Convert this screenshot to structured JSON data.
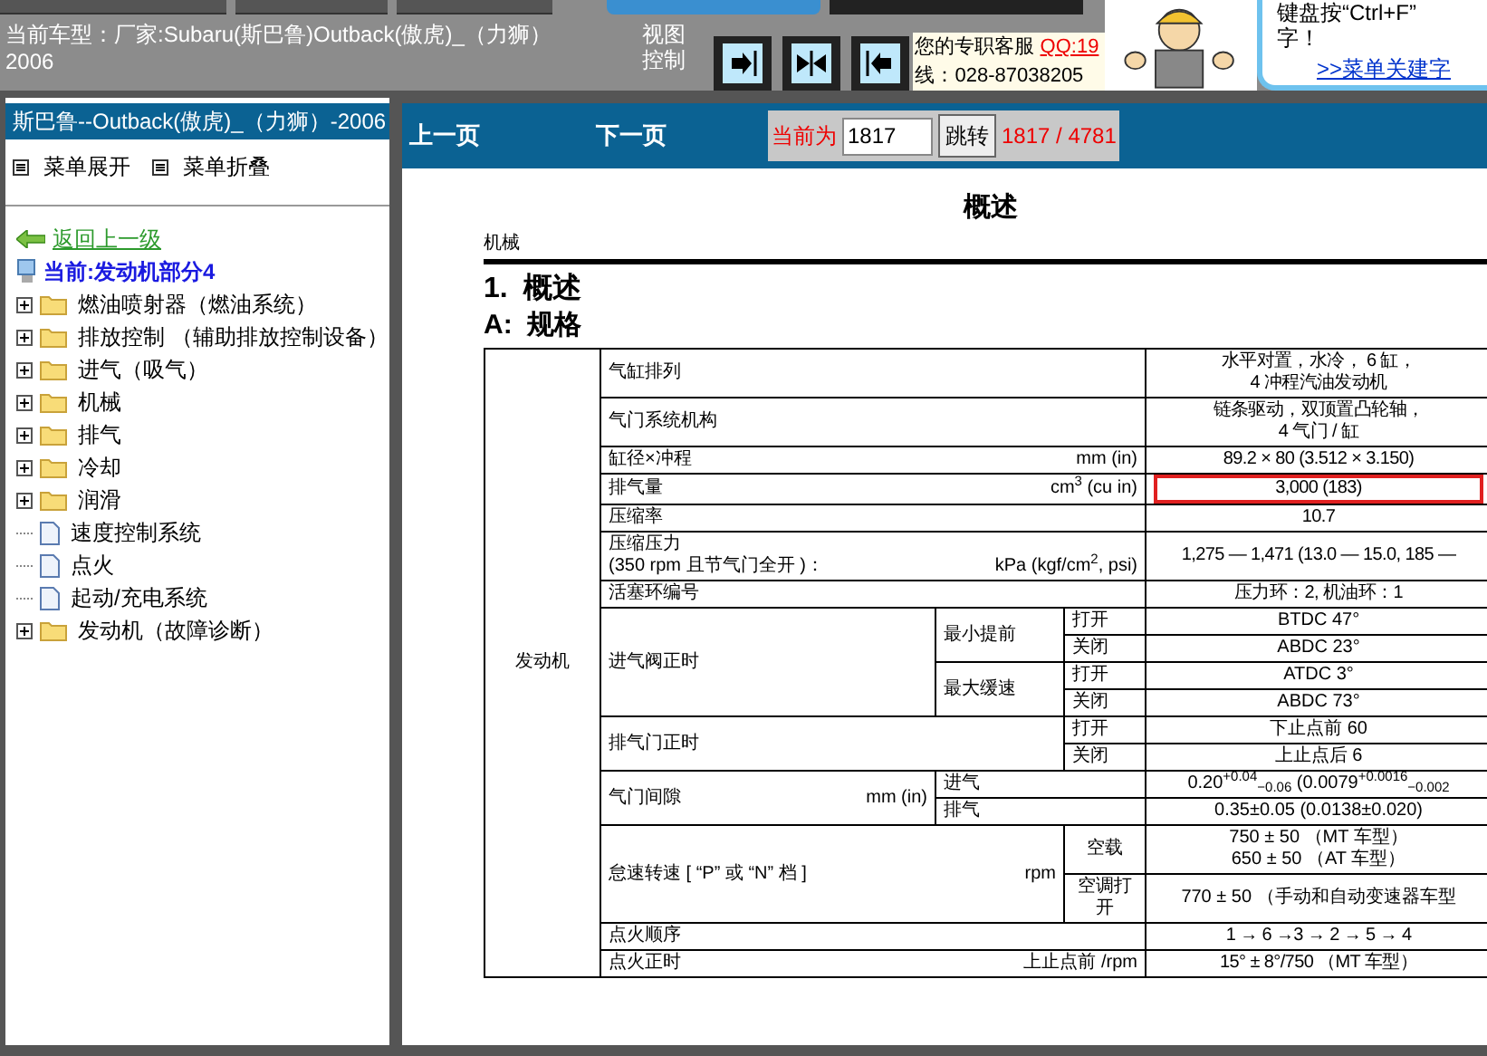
{
  "header": {
    "vehicle_lines": [
      "当前车型：厂家:Subaru(斯巴鲁)Outback(傲虎)_（力狮）",
      "2006"
    ],
    "view_label": "视图控制",
    "service_label": "您的专职客服",
    "service_qq": "QQ:19",
    "service_phone": "线：028-87038205",
    "tip_lines": [
      "键盘按“Ctrl+F”",
      "字！"
    ],
    "tip_link": ">>菜单关建字"
  },
  "sidebar": {
    "title": "斯巴鲁--Outback(傲虎)_（力狮）-2006",
    "menu_actions": [
      "菜单展开",
      "菜单折叠"
    ],
    "back_link": "返回上一级",
    "current": "当前:发动机部分4",
    "items": [
      {
        "kind": "folder",
        "label": "燃油喷射器（燃油系统）"
      },
      {
        "kind": "folder",
        "label": "排放控制 （辅助排放控制设备）"
      },
      {
        "kind": "folder",
        "label": "进气（吸气）"
      },
      {
        "kind": "folder",
        "label": "机械"
      },
      {
        "kind": "folder",
        "label": "排气"
      },
      {
        "kind": "folder",
        "label": "冷却"
      },
      {
        "kind": "folder",
        "label": "润滑"
      },
      {
        "kind": "page",
        "label": "速度控制系统"
      },
      {
        "kind": "page",
        "label": "点火"
      },
      {
        "kind": "page",
        "label": "起动/充电系统"
      },
      {
        "kind": "folder",
        "label": "发动机（故障诊断）"
      }
    ]
  },
  "pager": {
    "prev": "上一页",
    "next": "下一页",
    "current_label": "当前为",
    "page_input": "1817",
    "go_button": "跳转",
    "page_count": "1817 / 4781"
  },
  "document": {
    "page_title": "概述",
    "section": "机械",
    "heading_1": "1.  概述",
    "heading_2": "A:  规格",
    "spec_table": {
      "group": "发动机",
      "rows": [
        {
          "kind": "simple",
          "label_lines": [
            "气缸排列"
          ],
          "value_lines": [
            "水平对置，水冷， 6 缸，",
            "4 冲程汽油发动机"
          ],
          "highlighted": false
        },
        {
          "kind": "simple",
          "label_lines": [
            "气门系统机构"
          ],
          "value_lines": [
            "链条驱动，双顶置凸轮轴，",
            "4 气门 / 缸"
          ],
          "highlighted": false
        },
        {
          "kind": "simple",
          "label_lines": [
            "缸径×冲程"
          ],
          "unit": "mm (in)",
          "value_lines": [
            "89.2 × 80 (3.512 × 3.150)"
          ],
          "highlighted": false
        },
        {
          "kind": "simple",
          "label_lines": [
            "排气量"
          ],
          "unit": "cm$^{3}$ (cu in)",
          "value_lines": [
            "3,000 (183)"
          ],
          "highlighted": true
        },
        {
          "kind": "simple",
          "label_lines": [
            "压缩率"
          ],
          "value_lines": [
            "10.7"
          ],
          "highlighted": false
        },
        {
          "kind": "simple",
          "label_lines": [
            "压缩压力",
            "(350 rpm 且节气门全开 )："
          ],
          "unit": "kPa (kgf/cm$^{2}$, psi)",
          "value_lines": [
            "1,275 — 1,471 (13.0 — 15.0, 185 —"
          ],
          "highlighted": false
        },
        {
          "kind": "simple",
          "label_lines": [
            "活塞环编号"
          ],
          "value_lines": [
            "压力环：2, 机油环：1"
          ],
          "highlighted": false
        },
        {
          "kind": "timing",
          "label": "进气阀正时",
          "groups": [
            {
              "label": "最小提前",
              "entries": [
                {
                  "state": "打开",
                  "value": "BTDC 47°"
                },
                {
                  "state": "关闭",
                  "value": "ABDC 23°"
                }
              ]
            },
            {
              "label": "最大缓速",
              "entries": [
                {
                  "state": "打开",
                  "value": "ATDC 3°"
                },
                {
                  "state": "关闭",
                  "value": "ABDC 73°"
                }
              ]
            }
          ]
        },
        {
          "kind": "paired",
          "label": "排气门正时",
          "entries": [
            {
              "state": "打开",
              "value": "下止点前 60"
            },
            {
              "state": "关闭",
              "value": "上止点后 6"
            }
          ]
        },
        {
          "kind": "clearance",
          "label": "气门间隙",
          "unit": "mm (in)",
          "entries": [
            {
              "state": "进气",
              "value": "0.20$^{+0.04}$$_{−0.06}$ (0.0079$^{+0.0016}$$_{−0.002}$"
            },
            {
              "state": "排气",
              "value": "0.35±0.05 (0.0138±0.020)"
            }
          ]
        },
        {
          "kind": "idle",
          "label": "怠速转速 [ “P” 或 “N” 档 ]",
          "unit": "rpm",
          "entries": [
            {
              "state_lines": [
                "空载"
              ],
              "value_lines": [
                "750 ± 50 （MT 车型）",
                "650 ± 50 （AT 车型）"
              ]
            },
            {
              "state_lines": [
                "空调打",
                "开"
              ],
              "value_lines": [
                "770 ± 50 （手动和自动变速器车型"
              ]
            }
          ]
        },
        {
          "kind": "simple",
          "label_lines": [
            "点火顺序"
          ],
          "value_lines": [
            "1 → 6 →3 → 2 → 5 → 4"
          ],
          "highlighted": false
        },
        {
          "kind": "simple",
          "label_lines": [
            "点火正时"
          ],
          "unit": "上止点前 /rpm",
          "value_lines": [
            "15° ± 8°/750 （MT 车型）"
          ],
          "highlighted": false
        }
      ]
    }
  }
}
